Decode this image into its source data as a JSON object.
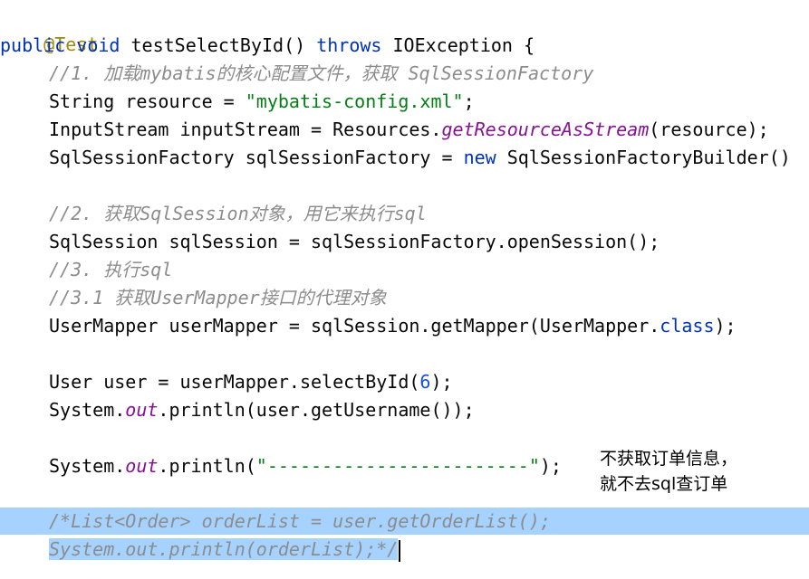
{
  "editor": {
    "annotation": "@Test",
    "method_sig": {
      "mod": "public",
      "ret": "void",
      "name": "testSelectById()",
      "throws": "throws",
      "exc": "IOException {"
    },
    "comment1": "//1. 加载mybatis的核心配置文件，获取 SqlSessionFactory",
    "line_resource": {
      "pre": "String resource = ",
      "str": "\"mybatis-config.xml\"",
      "post": ";"
    },
    "line_stream": {
      "pre": "InputStream inputStream = Resources.",
      "method": "getResourceAsStream",
      "post": "(resource);"
    },
    "line_factory": {
      "pre": "SqlSessionFactory sqlSessionFactory = ",
      "kw": "new",
      "post": " SqlSessionFactoryBuilder()"
    },
    "comment2": "//2. 获取SqlSession对象，用它来执行sql",
    "line_session": "SqlSession sqlSession = sqlSessionFactory.openSession();",
    "comment3": "//3. 执行sql",
    "comment31": "//3.1 获取UserMapper接口的代理对象",
    "line_mapper": {
      "pre": "UserMapper userMapper = sqlSession.getMapper(UserMapper.",
      "kw": "class",
      "post": ");"
    },
    "line_user": {
      "pre": "User user = userMapper.selectById(",
      "num": "6",
      "post": ");"
    },
    "line_print1": {
      "pre": "System.",
      "field": "out",
      "post": ".println(user.getUsername());"
    },
    "line_print2": {
      "pre": "System.",
      "field": "out",
      "post": ".println(",
      "str": "\"------------------------\"",
      "end": ");"
    },
    "comment_block1": "/*List<Order> orderList = user.getOrderList();",
    "comment_block2": "System.out.println(orderList);*/"
  },
  "note": {
    "line1": "不获取订单信息，",
    "line2": "就不去sql查订单"
  }
}
